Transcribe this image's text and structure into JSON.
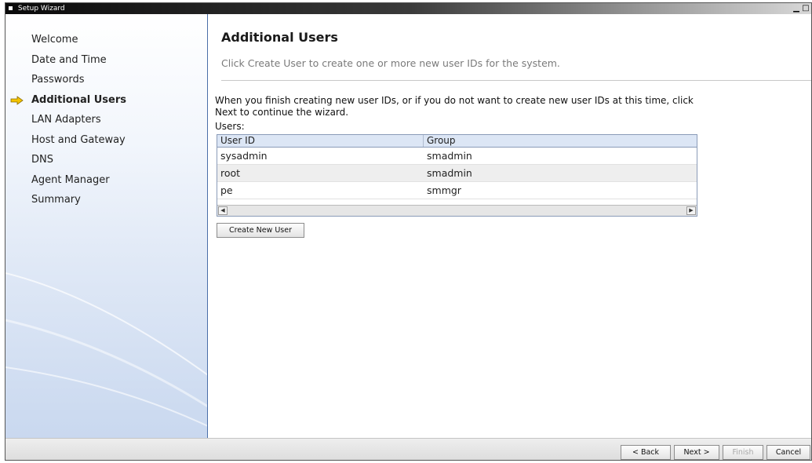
{
  "window": {
    "title": "Setup Wizard",
    "controls": {
      "minimize": "▁",
      "maximize": "□"
    }
  },
  "sidebar": {
    "items": [
      {
        "label": "Welcome",
        "active": false
      },
      {
        "label": "Date and Time",
        "active": false
      },
      {
        "label": "Passwords",
        "active": false
      },
      {
        "label": "Additional Users",
        "active": true
      },
      {
        "label": "LAN Adapters",
        "active": false
      },
      {
        "label": "Host and Gateway",
        "active": false
      },
      {
        "label": "DNS",
        "active": false
      },
      {
        "label": "Agent Manager",
        "active": false
      },
      {
        "label": "Summary",
        "active": false
      }
    ],
    "current_icon": "arrow-right-icon"
  },
  "main": {
    "title": "Additional Users",
    "subtitle": "Click Create User to create one or more new user IDs for the system.",
    "instructions": "When you finish creating new user IDs, or if you do not want to create new user IDs at this time, click Next to continue the wizard.",
    "users_label": "Users:",
    "table": {
      "columns": [
        "User ID",
        "Group"
      ],
      "rows": [
        [
          "sysadmin",
          "smadmin"
        ],
        [
          "root",
          "smadmin"
        ],
        [
          "pe",
          "smmgr"
        ]
      ]
    },
    "create_button": "Create New User"
  },
  "footer": {
    "back": "< Back",
    "next": "Next >",
    "finish": "Finish",
    "cancel": "Cancel"
  },
  "colors": {
    "sidebar_border": "#4a6ea8",
    "header_bg": "#dce6f5",
    "arrow_fill": "#f5c400"
  }
}
